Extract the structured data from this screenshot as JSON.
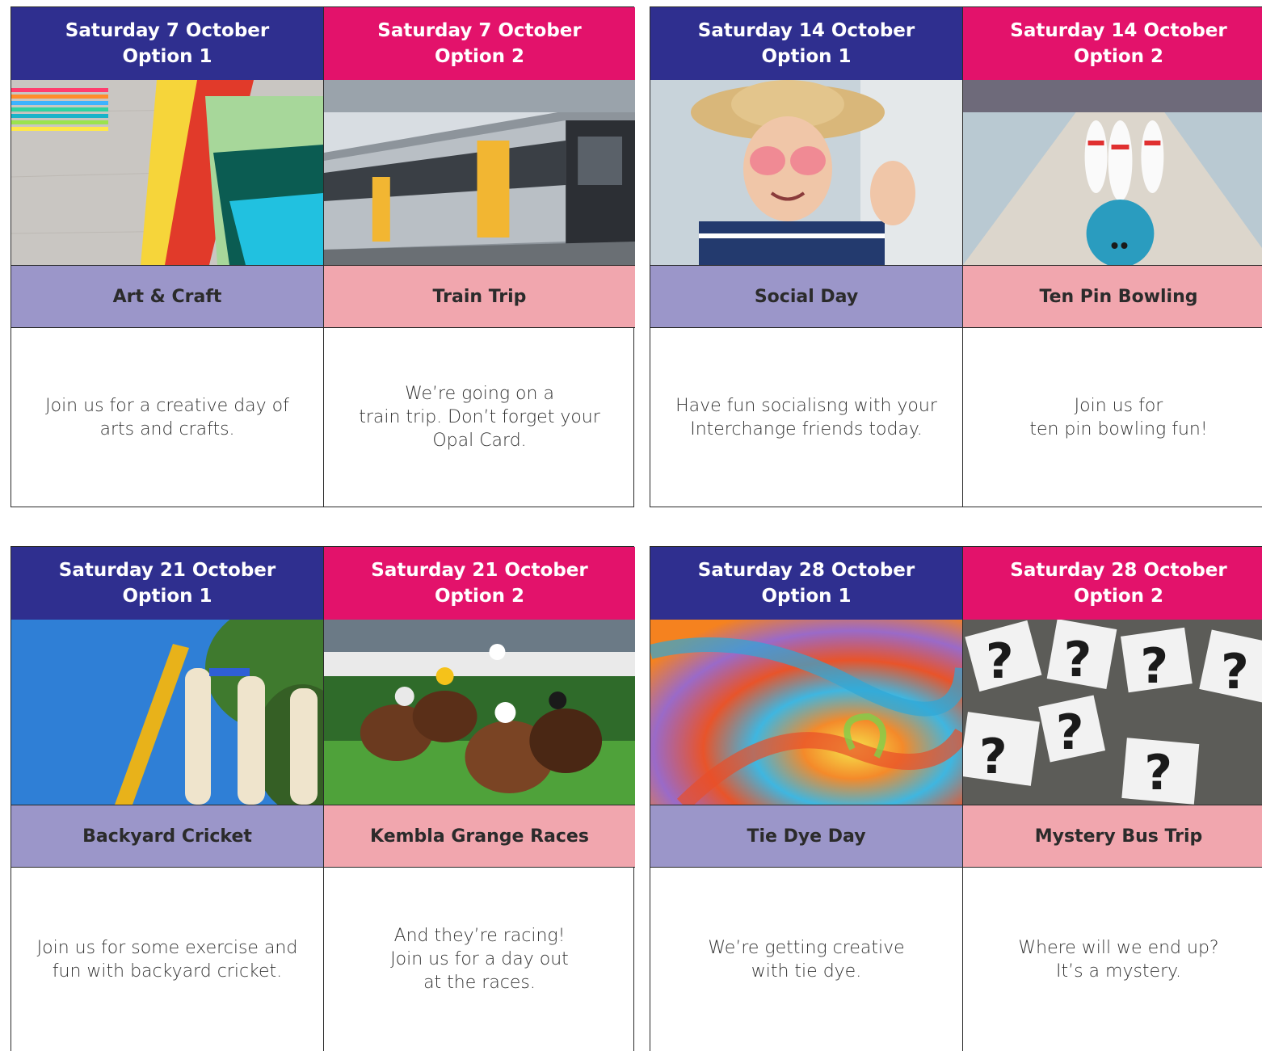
{
  "blocks": [
    {
      "options": [
        {
          "date": "Saturday 7 October",
          "option": "Option 1",
          "photo_icon": "art-supplies",
          "title": "Art & Craft",
          "description": "Join us for a creative day of\narts and crafts."
        },
        {
          "date": "Saturday 7 October",
          "option": "Option 2",
          "photo_icon": "train",
          "title": "Train Trip",
          "description": "We’re going on a\ntrain trip. Don’t forget your\nOpal Card."
        }
      ]
    },
    {
      "options": [
        {
          "date": "Saturday 14 October",
          "option": "Option 1",
          "photo_icon": "smiling-person",
          "title": "Social Day",
          "description": "Have fun socialisng  with your\nInterchange friends today."
        },
        {
          "date": "Saturday 14 October",
          "option": "Option 2",
          "photo_icon": "bowling",
          "title": "Ten Pin Bowling",
          "description": "Join us for\nten pin bowling fun!"
        }
      ]
    },
    {
      "options": [
        {
          "date": "Saturday 21 October",
          "option": "Option 1",
          "photo_icon": "cricket-wicket",
          "title": "Backyard Cricket",
          "description": "Join us for some exercise and\nfun with backyard cricket."
        },
        {
          "date": "Saturday 21 October",
          "option": "Option 2",
          "photo_icon": "horse-race",
          "title": "Kembla Grange Races",
          "description": "And they’re racing!\nJoin us for a day out\nat the races."
        }
      ]
    },
    {
      "options": [
        {
          "date": "Saturday 28 October",
          "option": "Option 1",
          "photo_icon": "tie-dye",
          "title": "Tie Dye Day",
          "description": "We’re getting creative\nwith tie dye."
        },
        {
          "date": "Saturday 28 October",
          "option": "Option 2",
          "photo_icon": "question-marks",
          "title": "Mystery Bus Trip",
          "description": "Where will we end up?\nIt’s a mystery."
        }
      ]
    }
  ],
  "colors": {
    "option1_header": "#2f2f8f",
    "option2_header": "#e3126b",
    "option1_title": "#9b96c9",
    "option2_title": "#f1a6ae"
  }
}
